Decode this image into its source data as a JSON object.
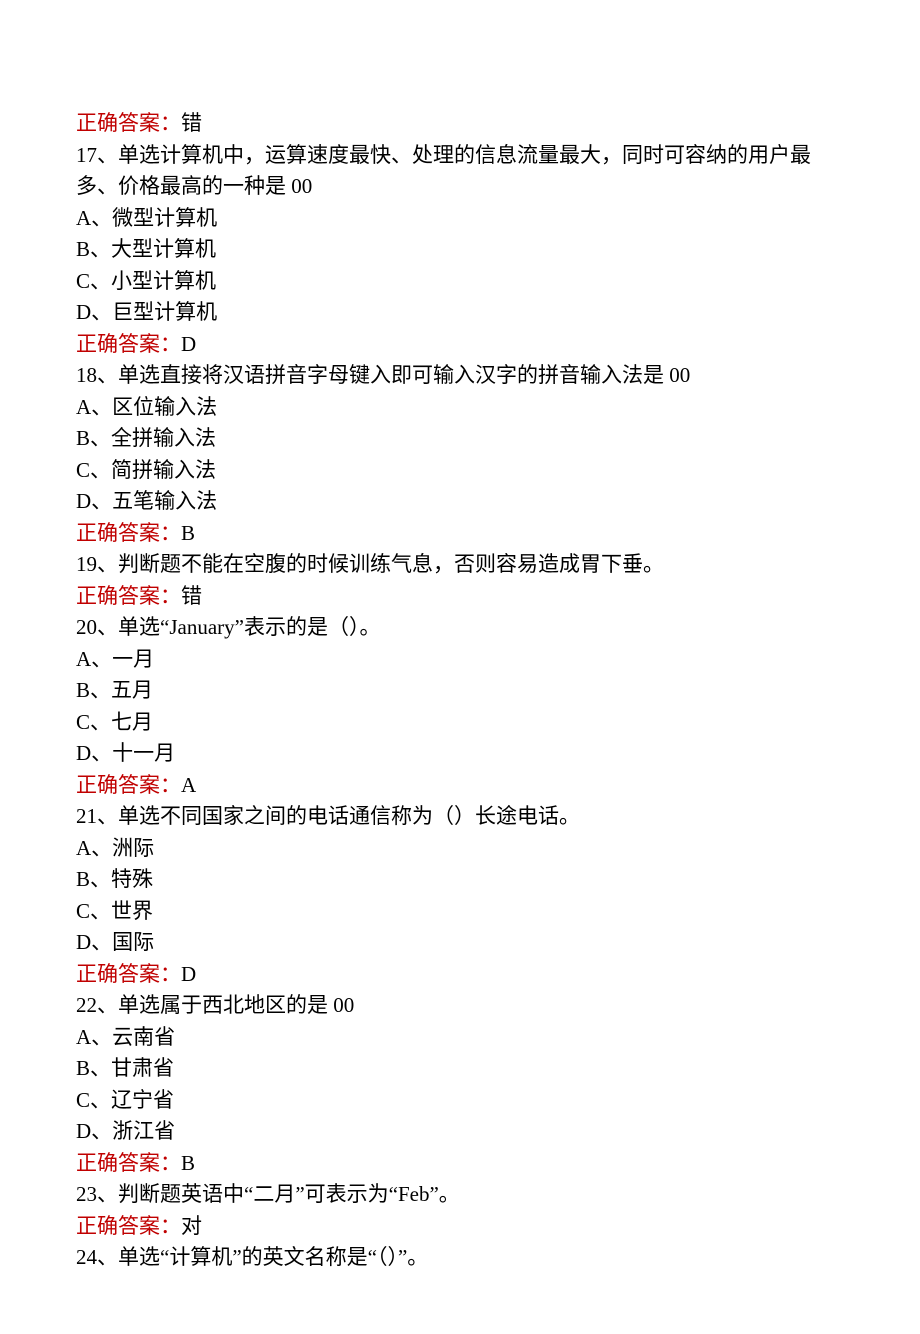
{
  "answer_label": "正确答案：",
  "items": [
    {
      "type": "answer",
      "value": "错"
    },
    {
      "type": "question",
      "number": "17",
      "qtype": "单选",
      "text": "计算机中，运算速度最快、处理的信息流量最大，同时可容纳的用户最多、价格最高的一种是 00"
    },
    {
      "type": "option",
      "letter": "A",
      "text": "微型计算机"
    },
    {
      "type": "option",
      "letter": "B",
      "text": "大型计算机"
    },
    {
      "type": "option",
      "letter": "C",
      "text": "小型计算机"
    },
    {
      "type": "option",
      "letter": "D",
      "text": "巨型计算机"
    },
    {
      "type": "answer",
      "value": "D"
    },
    {
      "type": "question",
      "number": "18",
      "qtype": "单选",
      "text": "直接将汉语拼音字母键入即可输入汉字的拼音输入法是 00"
    },
    {
      "type": "option",
      "letter": "A",
      "text": "区位输入法"
    },
    {
      "type": "option",
      "letter": "B",
      "text": "全拼输入法"
    },
    {
      "type": "option",
      "letter": "C",
      "text": "简拼输入法"
    },
    {
      "type": "option",
      "letter": "D",
      "text": "五笔输入法"
    },
    {
      "type": "answer",
      "value": "B"
    },
    {
      "type": "question",
      "number": "19",
      "qtype": "判断题",
      "text": "不能在空腹的时候训练气息，否则容易造成胃下垂。"
    },
    {
      "type": "answer",
      "value": "错"
    },
    {
      "type": "question",
      "number": "20",
      "qtype": "单选",
      "text": "“January”表示的是（）。"
    },
    {
      "type": "option",
      "letter": "A",
      "text": "一月"
    },
    {
      "type": "option",
      "letter": "B",
      "text": "五月"
    },
    {
      "type": "option",
      "letter": "C",
      "text": "七月"
    },
    {
      "type": "option",
      "letter": "D",
      "text": "十一月"
    },
    {
      "type": "answer",
      "value": "A"
    },
    {
      "type": "question",
      "number": "21",
      "qtype": "单选",
      "text": "不同国家之间的电话通信称为（）长途电话。"
    },
    {
      "type": "option",
      "letter": "A",
      "text": "洲际"
    },
    {
      "type": "option",
      "letter": "B",
      "text": "特殊"
    },
    {
      "type": "option",
      "letter": "C",
      "text": "世界"
    },
    {
      "type": "option",
      "letter": "D",
      "text": "国际"
    },
    {
      "type": "answer",
      "value": "D"
    },
    {
      "type": "question",
      "number": "22",
      "qtype": "单选",
      "text": "属于西北地区的是 00"
    },
    {
      "type": "option",
      "letter": "A",
      "text": "云南省"
    },
    {
      "type": "option",
      "letter": "B",
      "text": "甘肃省"
    },
    {
      "type": "option",
      "letter": "C",
      "text": "辽宁省"
    },
    {
      "type": "option",
      "letter": "D",
      "text": "浙江省"
    },
    {
      "type": "answer",
      "value": "B"
    },
    {
      "type": "question",
      "number": "23",
      "qtype": "判断题",
      "text": "英语中“二月”可表示为“Feb”。"
    },
    {
      "type": "answer",
      "value": "对"
    },
    {
      "type": "question",
      "number": "24",
      "qtype": "单选",
      "text": "“计算机”的英文名称是“（）”。"
    }
  ]
}
